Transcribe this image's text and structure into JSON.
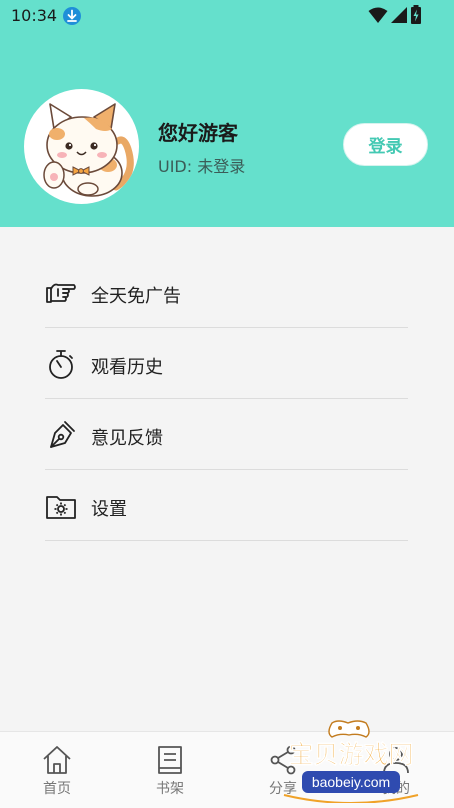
{
  "status_bar": {
    "time": "10:34",
    "icons": [
      "download-icon",
      "wifi-icon",
      "signal-icon",
      "battery-icon"
    ]
  },
  "profile": {
    "greeting": "您好游客",
    "uid_text": "UID: 未登录",
    "login_label": "登录",
    "avatar": "cat-avatar"
  },
  "menu": {
    "items": [
      {
        "label": "全天免广告",
        "icon": "pointing-hand-icon"
      },
      {
        "label": "观看历史",
        "icon": "stopwatch-icon"
      },
      {
        "label": "意见反馈",
        "icon": "pen-nib-icon"
      },
      {
        "label": "设置",
        "icon": "folder-gear-icon"
      }
    ]
  },
  "nav": {
    "items": [
      {
        "label": "首页",
        "icon": "home-icon"
      },
      {
        "label": "书架",
        "icon": "book-icon"
      },
      {
        "label": "分享",
        "icon": "share-icon"
      },
      {
        "label": "我的",
        "icon": "person-icon"
      }
    ]
  },
  "watermark": {
    "title": "宝贝游戏网",
    "url": "baobeiy.com"
  },
  "colors": {
    "header": "#65e0cc",
    "accent": "#44c9b3",
    "background": "#f4f4f4"
  }
}
